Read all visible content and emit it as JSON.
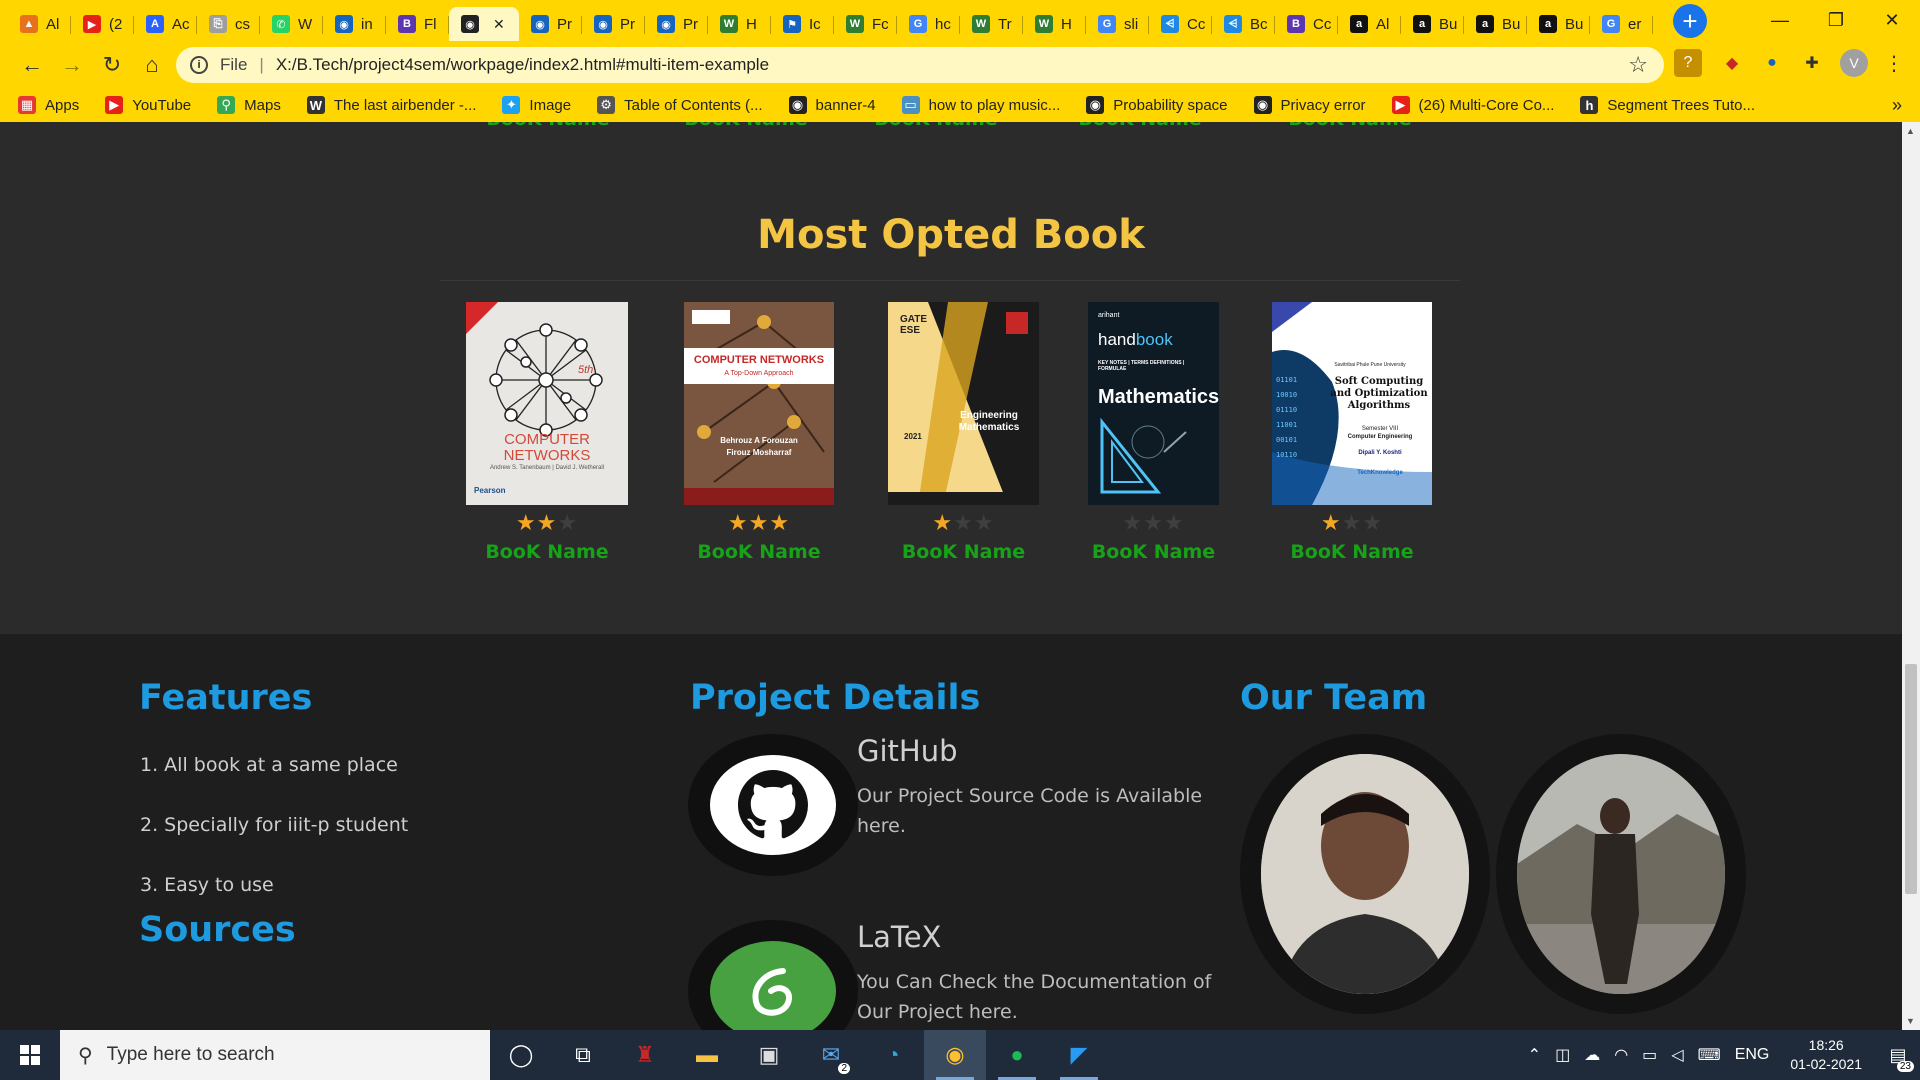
{
  "browser": {
    "tabs": [
      {
        "label": "Al",
        "color": "#e8711c",
        "glyph": "▲"
      },
      {
        "label": "(2",
        "color": "#e62117",
        "glyph": "▶"
      },
      {
        "label": "Ac",
        "color": "#2962ff",
        "glyph": "A"
      },
      {
        "label": "cs",
        "color": "#9e9e9e",
        "glyph": "⎘"
      },
      {
        "label": "W",
        "color": "#25d366",
        "glyph": "✆"
      },
      {
        "label": "in",
        "color": "#1565c0",
        "glyph": "◉"
      },
      {
        "label": "Fl",
        "color": "#5e35b1",
        "glyph": "B"
      },
      {
        "label": "",
        "color": "#222222",
        "glyph": "◉",
        "active": true
      },
      {
        "label": "Pr",
        "color": "#1565c0",
        "glyph": "◉"
      },
      {
        "label": "Pr",
        "color": "#1565c0",
        "glyph": "◉"
      },
      {
        "label": "Pr",
        "color": "#1565c0",
        "glyph": "◉"
      },
      {
        "label": "H",
        "color": "#2e7d32",
        "glyph": "W"
      },
      {
        "label": "Ic",
        "color": "#1565c0",
        "glyph": "⚑"
      },
      {
        "label": "Fc",
        "color": "#2e7d32",
        "glyph": "W"
      },
      {
        "label": "hc",
        "color": "#4285f4",
        "glyph": "G"
      },
      {
        "label": "Tr",
        "color": "#2e7d32",
        "glyph": "W"
      },
      {
        "label": "H",
        "color": "#2e7d32",
        "glyph": "W"
      },
      {
        "label": "sli",
        "color": "#4285f4",
        "glyph": "G"
      },
      {
        "label": "Cc",
        "color": "#1e88e5",
        "glyph": "⩤"
      },
      {
        "label": "Bc",
        "color": "#1e88e5",
        "glyph": "⩤"
      },
      {
        "label": "Cc",
        "color": "#5e35b1",
        "glyph": "B"
      },
      {
        "label": "Al",
        "color": "#111111",
        "glyph": "a"
      },
      {
        "label": "Bu",
        "color": "#111111",
        "glyph": "a"
      },
      {
        "label": "Bu",
        "color": "#111111",
        "glyph": "a"
      },
      {
        "label": "Bu",
        "color": "#111111",
        "glyph": "a"
      },
      {
        "label": "er",
        "color": "#4285f4",
        "glyph": "G"
      }
    ],
    "active_close": "✕",
    "new_tab": "+",
    "window_controls": {
      "minimize": "—",
      "restore": "❐",
      "close": "✕"
    },
    "toolbar": {
      "back": "←",
      "forward": "→",
      "reload": "↻",
      "home": "⌂"
    },
    "address": {
      "scheme": "File",
      "separator": "|",
      "url": "X:/B.Tech/project4sem/workpage/index2.html#multi-item-example",
      "info_icon": "i",
      "star": "☆"
    },
    "extensions": [
      {
        "glyph": "?",
        "color": "#c58f00"
      },
      {
        "glyph": "◆",
        "color": "#c62828"
      },
      {
        "glyph": "●",
        "color": "#1565c0"
      },
      {
        "glyph": "✚",
        "color": "#333333"
      }
    ],
    "profile_initial": "V",
    "menu": "⋮",
    "bookmarks": [
      {
        "label": "Apps",
        "glyph": "▦",
        "color": "#e53935"
      },
      {
        "label": "YouTube",
        "glyph": "▶",
        "color": "#e62117"
      },
      {
        "label": "Maps",
        "glyph": "⚲",
        "color": "#34a853"
      },
      {
        "label": "The last airbender -...",
        "glyph": "W",
        "color": "#333333"
      },
      {
        "label": "Image",
        "glyph": "✦",
        "color": "#1da1f2"
      },
      {
        "label": "Table of Contents (...",
        "glyph": "⚙",
        "color": "#555555"
      },
      {
        "label": "banner-4",
        "glyph": "◉",
        "color": "#222222"
      },
      {
        "label": "how to play music...",
        "glyph": "▭",
        "color": "#4a90c2"
      },
      {
        "label": "Probability space",
        "glyph": "◉",
        "color": "#222222"
      },
      {
        "label": "Privacy error",
        "glyph": "◉",
        "color": "#222222"
      },
      {
        "label": "(26) Multi-Core Co...",
        "glyph": "▶",
        "color": "#e62117"
      },
      {
        "label": "Segment Trees Tuto...",
        "glyph": "h",
        "color": "#333333"
      }
    ],
    "bookmarks_more": "»"
  },
  "page": {
    "top_row_names": [
      "BooK Name",
      "BooK Name",
      "BooK Name",
      "BooK Name",
      "BooK Name"
    ],
    "section_title": "Most Opted Book",
    "books": [
      {
        "name": "BooK Name",
        "rating": 2,
        "cover": {
          "title": "COMPUTER NETWORKS",
          "edition": "5th",
          "authors": "Andrew S. Tanenbaum | David J. Wetherall",
          "publisher": "Pearson"
        }
      },
      {
        "name": "BooK Name",
        "rating": 3,
        "cover": {
          "title": "COMPUTER NETWORKS",
          "subtitle": "A Top-Down Approach",
          "authors": "Behrouz A Forouzan",
          "authors2": "Firouz Mosharraf"
        }
      },
      {
        "name": "BooK Name",
        "rating": 1,
        "cover": {
          "tag": "GATE ESE",
          "title": "Engineering Mathematics",
          "year": "2021"
        }
      },
      {
        "name": "BooK Name",
        "rating": 0,
        "cover": {
          "brand": "arihant",
          "title1": "hand",
          "title2": "book",
          "line": "KEY NOTES | TERMS DEFINITIONS | FORMULAE",
          "title": "Mathematics"
        }
      },
      {
        "name": "BooK Name",
        "rating": 1,
        "cover": {
          "university": "Savitribai Phule Pune University",
          "title": "Soft Computing and Optimization Algorithms",
          "semester": "Semester VIII",
          "branch": "Computer Engineering",
          "authors": "Dipali Y. Koshti",
          "publisher": "TechKnowledge"
        }
      }
    ],
    "star_glyph": "★",
    "footer": {
      "features_title": "Features",
      "features": [
        "1. All book at a same place",
        "2. Specially for iiit-p student",
        "3. Easy to use"
      ],
      "sources_title": "Sources",
      "project_title": "Project Details",
      "details": [
        {
          "title": "GitHub",
          "text": "Our Project Source Code is Available here."
        },
        {
          "title": "LaTeX",
          "text": "You Can Check the Documentation of Our Project here."
        }
      ],
      "team_title": "Our Team"
    }
  },
  "taskbar": {
    "search_placeholder": "Type here to search",
    "mail_badge": "2",
    "tray_language": "ENG",
    "time": "18:26",
    "date": "01-02-2021",
    "notifications": "23"
  }
}
